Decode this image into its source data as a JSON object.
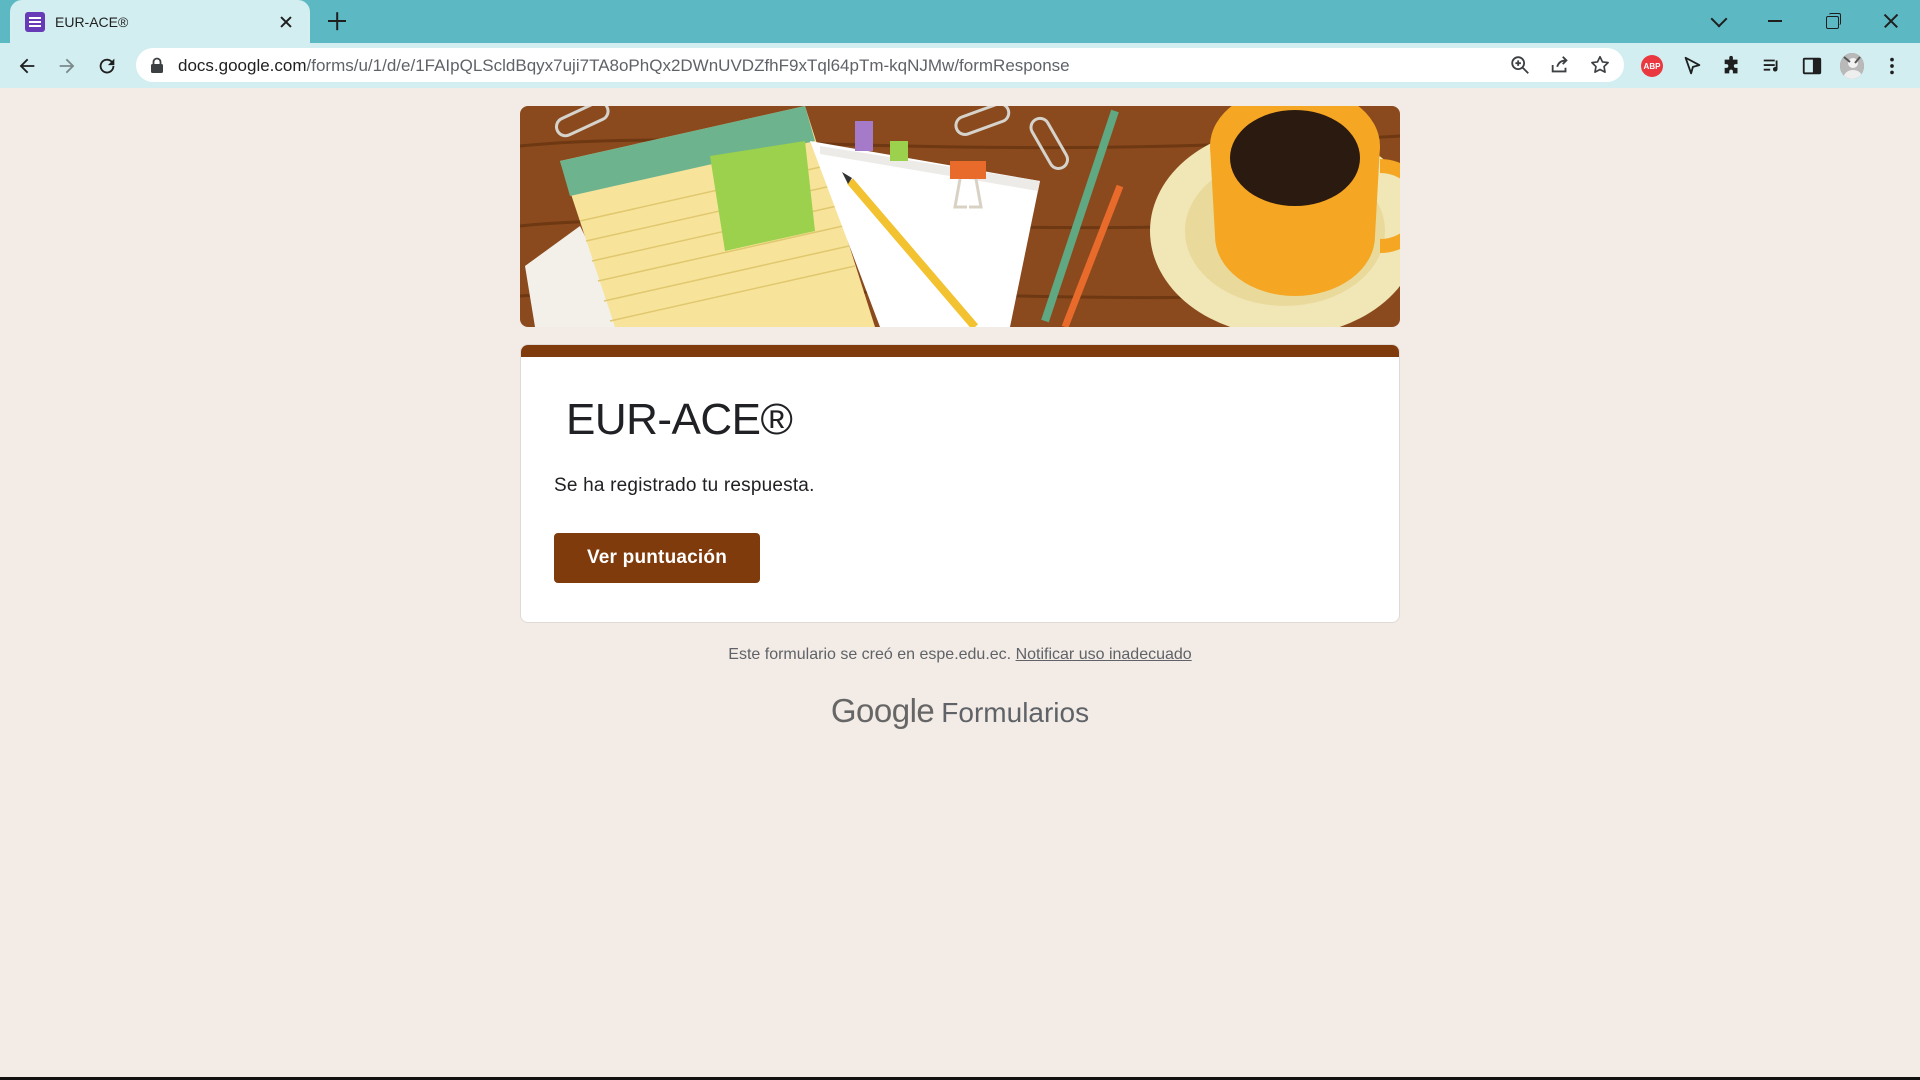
{
  "browser": {
    "tab_title": "EUR-ACE®",
    "url_host": "docs.google.com",
    "url_path": "/forms/u/1/d/e/1FAIpQLScldBqyx7uji7TA8oPhQx2DWnUVDZfhF9xTql64pTm-kqNJMw/formResponse",
    "extension_badge": "ABP"
  },
  "form": {
    "title": "EUR-ACE®",
    "confirmation": "Se ha registrado tu respuesta.",
    "score_button": "Ver puntuación",
    "accent_color": "#7f3b0c"
  },
  "footer": {
    "created_text": "Este formulario se creó en espe.edu.ec.",
    "report_link": "Notificar uso inadecuado",
    "brand_google": "Google",
    "brand_product": "Formularios"
  }
}
